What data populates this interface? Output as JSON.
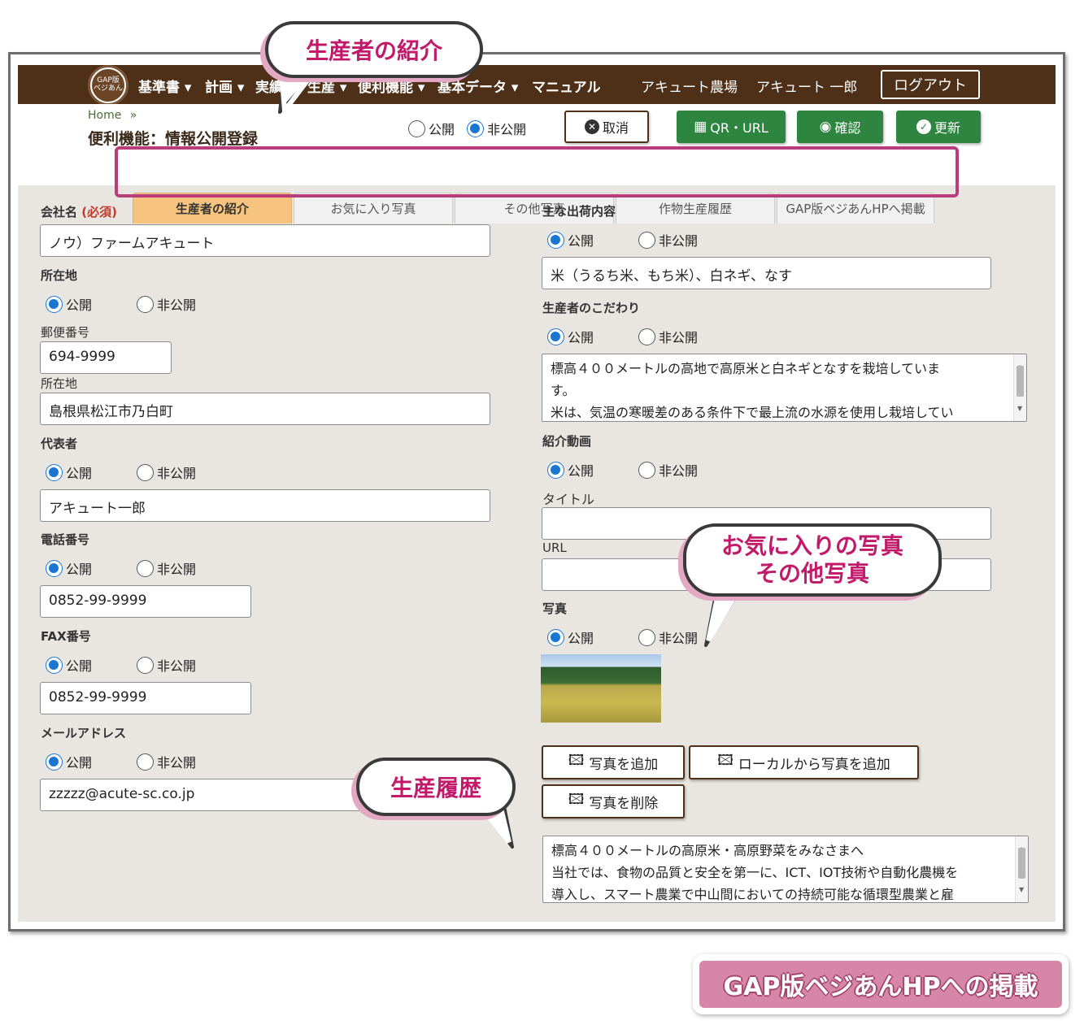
{
  "nav": {
    "logo_line1": "GAP版",
    "logo_line2": "ベジあん",
    "items": [
      "基準書 ▾",
      "計画 ▾",
      "実績 ▾",
      "生産 ▾",
      "便利機能 ▾",
      "基本データ ▾",
      "マニュアル"
    ],
    "farm": "アキュート農場",
    "user": "アキュート 一郎",
    "logout": "ログアウト"
  },
  "header": {
    "breadcrumb_home": "Home",
    "breadcrumb_sep": "»",
    "title": "便利機能：情報公開登録",
    "public": "公開",
    "private": "非公開",
    "cancel": "取消",
    "qr": "QR・URL",
    "confirm": "確認",
    "update": "更新"
  },
  "tabs": [
    "生産者の紹介",
    "お気に入り写真",
    "その他写真",
    "作物生産履歴",
    "GAP版ベジあんHPへ掲載"
  ],
  "form": {
    "public": "公開",
    "private": "非公開",
    "company_label": "会社名",
    "required": "(必須)",
    "company_value": "ノウ）ファームアキュート",
    "address_label": "所在地",
    "postal_label": "郵便番号",
    "postal_value": "694-9999",
    "address_sub_label": "所在地",
    "address_value": "島根県松江市乃白町",
    "rep_label": "代表者",
    "rep_value": "アキュート一郎",
    "tel_label": "電話番号",
    "tel_value": "0852-99-9999",
    "fax_label": "FAX番号",
    "fax_value": "0852-99-9999",
    "mail_label": "メールアドレス",
    "mail_value": "zzzzz@acute-sc.co.jp",
    "ship_label": "主な出荷内容",
    "ship_value": "米（うるち米、もち米）、白ネギ、なす",
    "policy_label": "生産者のこだわり",
    "policy_lines": [
      "標高４００メートルの高地で高原米と白ネギとなすを栽培していま",
      "す。",
      "米は、気温の寒暖差のある条件下で最上流の水源を使用し栽培してい"
    ],
    "video_label": "紹介動画",
    "video_title_label": "タイトル",
    "video_url_label": "URL",
    "photo_label": "写真",
    "add_photo": "写真を追加",
    "add_local_photo": "ローカルから写真を追加",
    "delete_photo": "写真を削除",
    "photo_text_lines": [
      "標高４００メートルの高原米・高原野菜をみなさまへ",
      "当社では、食物の品質と安全を第一に、ICT、IOT技術や自動化農機を",
      "導入し、スマート農業で中山間においての持続可能な循環型農業と雇"
    ]
  },
  "callouts": {
    "producer": "生産者の紹介",
    "favorite_line1": "お気に入りの写真",
    "favorite_line2": "その他写真",
    "history": "生産履歴",
    "badge": "GAP版ベジあんHPへの掲載"
  },
  "colors": {
    "nav_bg": "#4e2f17",
    "accent_green": "#2e8540",
    "active_tab": "#f6c47e",
    "callout_text": "#c2196a",
    "highlight": "#b83d7a",
    "radio_blue": "#1976d2"
  }
}
